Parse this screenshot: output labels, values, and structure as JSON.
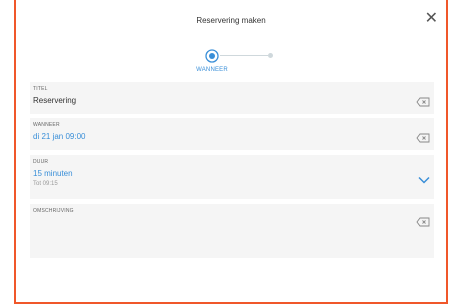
{
  "header": {
    "title": "Reservering maken",
    "close_icon": "close-icon"
  },
  "stepper": {
    "steps": [
      {
        "label": "WANNEER",
        "active": true
      },
      {
        "label": "",
        "active": false
      }
    ]
  },
  "form": {
    "title_field": {
      "label": "TITEL",
      "value": "Reservering"
    },
    "when_field": {
      "label": "WANNEER",
      "value": "di 21 jan 09:00"
    },
    "duration_field": {
      "label": "DUUR",
      "value": "15 minuten",
      "sub": "Tot 09:15"
    },
    "description_field": {
      "label": "OMSCHRIJVING",
      "value": ""
    }
  },
  "colors": {
    "accent": "#3a8fd8",
    "border": "#f0572a",
    "field_bg": "#f5f5f5"
  }
}
